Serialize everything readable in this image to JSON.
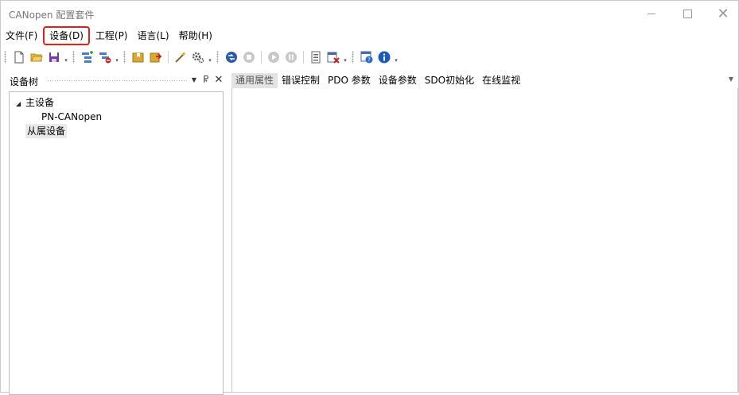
{
  "window": {
    "title": "CANopen 配置套件",
    "minimize_icon": "minimize-icon",
    "maximize_icon": "maximize-icon",
    "close_symbol": "✕"
  },
  "menu": {
    "items": [
      {
        "label": "文件(F)"
      },
      {
        "label": "设备(D)",
        "highlighted": true
      },
      {
        "label": "工程(P)"
      },
      {
        "label": "语言(L)"
      },
      {
        "label": "帮助(H)"
      }
    ]
  },
  "toolbar": {
    "icons": [
      "new-file-icon",
      "open-folder-icon",
      "save-icon",
      "add-device-icon",
      "remove-device-icon",
      "import-icon",
      "export-icon",
      "wizard-icon",
      "settings-icon",
      "connect-icon",
      "stop-icon",
      "play-icon",
      "pause-icon",
      "device-info-icon",
      "delete-icon",
      "help-icon",
      "info-icon"
    ]
  },
  "device_tree": {
    "title": "设备树",
    "dropdown_symbol": "▼",
    "pin_symbol": "Ⴜ",
    "close_symbol": "✕",
    "nodes": [
      {
        "label": "主设备",
        "expander": "◢"
      },
      {
        "label": "PN-CANopen"
      },
      {
        "label": "从属设备",
        "selected": true
      }
    ]
  },
  "tabs": {
    "items": [
      {
        "label": "通用属性",
        "active": true
      },
      {
        "label": "错误控制"
      },
      {
        "label": "PDO 参数"
      },
      {
        "label": "设备参数"
      },
      {
        "label": "SDO初始化"
      },
      {
        "label": "在线监视"
      }
    ],
    "dropdown_symbol": "▼"
  },
  "colors": {
    "highlight_outline": "#e02020",
    "active_tab_bg": "#e3e3e3",
    "selected_node_bg": "#e9e9e9"
  }
}
